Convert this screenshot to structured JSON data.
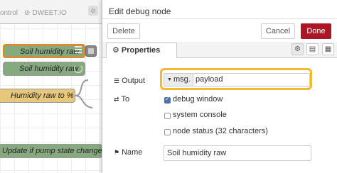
{
  "canvas": {
    "tabs": [
      {
        "label": "ontrol"
      },
      {
        "label": "DWEET.IO",
        "icon": "disabled-icon"
      }
    ],
    "nodes": {
      "soil_raw_1": "Soil humidity raw",
      "soil_raw_2": "Soil humidity raw",
      "humidity_pct": "Humidity raw to %",
      "pump_update": "Update if pump state changed"
    }
  },
  "panel": {
    "title": "Edit debug node",
    "delete_label": "Delete",
    "cancel_label": "Cancel",
    "done_label": "Done",
    "properties_tab": "Properties",
    "output_label": "Output",
    "output_type": "msg.",
    "output_value": "payload",
    "to_label": "To",
    "options": [
      {
        "label": "debug window",
        "checked": true
      },
      {
        "label": "system console",
        "checked": false
      },
      {
        "label": "node status (32 characters)",
        "checked": false
      }
    ],
    "name_label": "Name",
    "name_value": "Soil humidity raw"
  },
  "colors": {
    "done_button": "#ad1625",
    "highlight": "#f5b82e",
    "node_green": "#87a980",
    "node_yellow": "#e7c87a",
    "selected_border": "#ff7f0e"
  }
}
